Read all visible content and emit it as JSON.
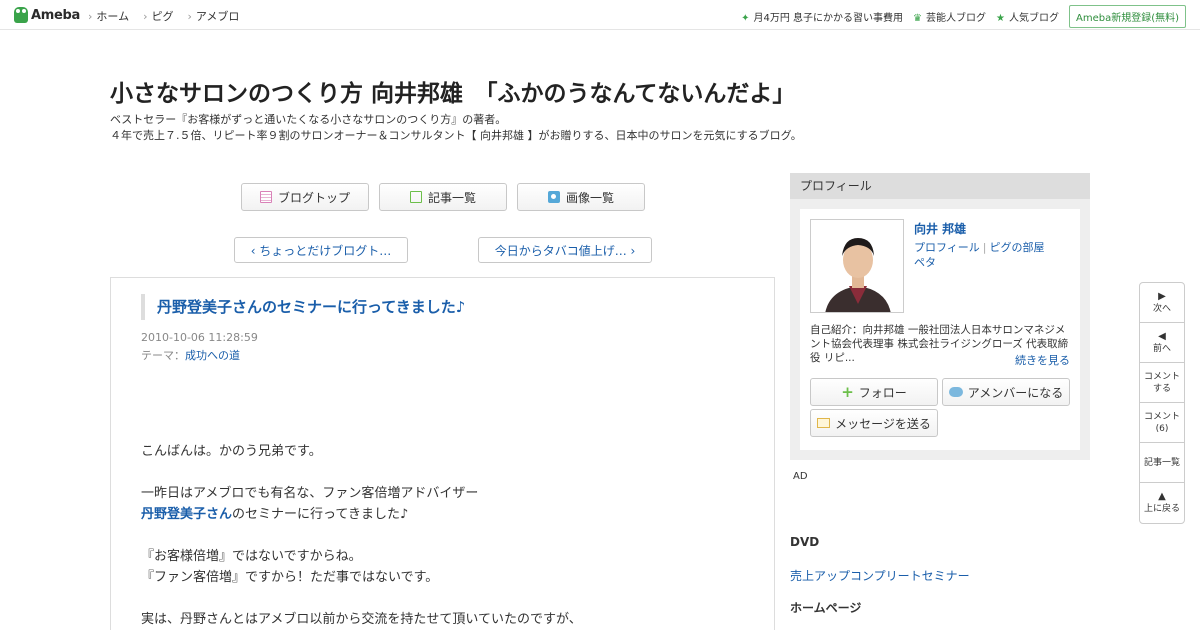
{
  "topnav": {
    "logo": "Ameba",
    "crumbs": [
      "ホーム",
      "ピグ",
      "アメブロ"
    ],
    "right_links": [
      {
        "icon": "sparkle-icon",
        "label": "月4万円 息子にかかる習い事費用"
      },
      {
        "icon": "crown-icon",
        "label": "芸能人ブログ"
      },
      {
        "icon": "star-icon",
        "label": "人気ブログ"
      }
    ],
    "register": "Ameba新規登録(無料)"
  },
  "blog": {
    "title": "小さなサロンのつくり方 向井邦雄　「ふかのうなんてないんだよ」",
    "desc_line1": "ベストセラー『お客様がずっと通いたくなる小さなサロンのつくり方』の著者。",
    "desc_line2": "４年で売上７.５倍、リピート率９割のサロンオーナー＆コンサルタント【 向井邦雄 】がお贈りする、日本中のサロンを元気にするブログ。"
  },
  "nav_buttons": {
    "blog_top": "ブログトップ",
    "articles": "記事一覧",
    "images": "画像一覧"
  },
  "pager": {
    "prev": "‹ ちょっとだけブログト…",
    "next": "今日からタバコ値上げ… ›"
  },
  "article": {
    "title": "丹野登美子さんのセミナーに行ってきました♪",
    "date": "2010-10-06 11:28:59",
    "theme_label": "テーマ：",
    "theme": "成功への道",
    "p1": "こんばんは。かのう兄弟です。",
    "p2a": "一昨日はアメブロでも有名な、ファン客倍増アドバイザー",
    "p2_link": "丹野登美子さん",
    "p2b": "のセミナーに行ってきました♪",
    "p3a": "『お客様倍増』ではないですからね。",
    "p3b": "『ファン客倍増』ですから！ただ事ではないです。",
    "p4": "実は、丹野さんとはアメブロ以前から交流を持たせて頂いていたのですが、"
  },
  "profile": {
    "header": "プロフィール",
    "name": "向井 邦雄",
    "link_profile": "プロフィール",
    "link_pig": "ピグの部屋",
    "link_peta": "ペタ",
    "intro": "自己紹介：向井邦雄 一般社団法人日本サロンマネジメント協会代表理事 株式会社ライジングローズ 代表取締役 リピ...",
    "more": "続きを見る",
    "follow": "フォロー",
    "member": "アメンバーになる",
    "message": "メッセージを送る"
  },
  "sidebar": {
    "ad": "AD",
    "dvd_heading": "DVD",
    "dvd_link": "売上アップコンプリートセミナー",
    "homepage_heading": "ホームページ"
  },
  "floatnav": {
    "next": "次へ",
    "prev": "前へ",
    "comment": "コメント\nする",
    "comments_label": "コメント",
    "comments_count": "(6)",
    "list": "記事一覧",
    "top": "上に戻る"
  },
  "colors": {
    "link": "#1a5eaa",
    "ameba_green": "#3aa34a"
  }
}
